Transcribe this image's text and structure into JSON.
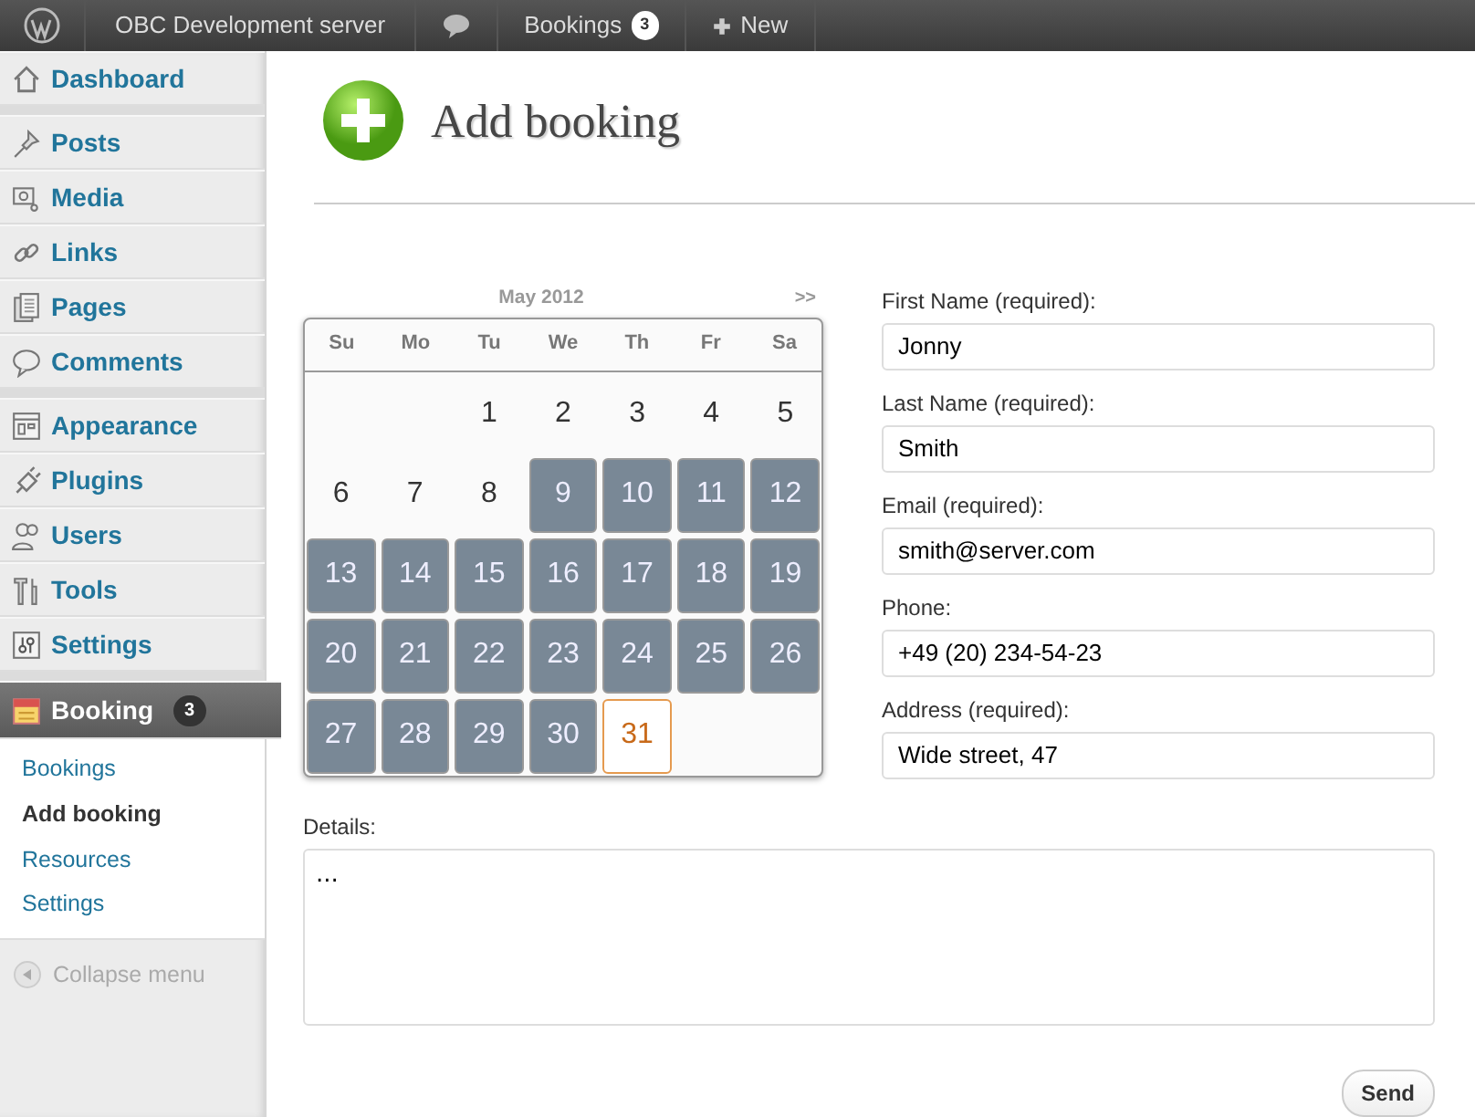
{
  "admin_bar": {
    "site": "OBC Development server",
    "bookings_label": "Bookings",
    "bookings_count": "3",
    "new_label": "New"
  },
  "sidebar": {
    "groups": [
      [
        {
          "label": "Dashboard",
          "kind": "house",
          "selected": false
        }
      ],
      [
        {
          "label": "Posts",
          "kind": "pin",
          "selected": false
        },
        {
          "label": "Media",
          "kind": "media",
          "selected": false
        },
        {
          "label": "Links",
          "kind": "link",
          "selected": false
        },
        {
          "label": "Pages",
          "kind": "pages",
          "selected": false
        },
        {
          "label": "Comments",
          "kind": "comment",
          "selected": false
        }
      ],
      [
        {
          "label": "Appearance",
          "kind": "layout",
          "selected": false
        },
        {
          "label": "Plugins",
          "kind": "plug",
          "selected": false
        },
        {
          "label": "Users",
          "kind": "users",
          "selected": false
        },
        {
          "label": "Tools",
          "kind": "tools",
          "selected": false
        },
        {
          "label": "Settings",
          "kind": "sliders",
          "selected": false
        }
      ],
      [
        {
          "label": "Booking",
          "kind": "calendar",
          "selected": true,
          "badge": "3",
          "children": [
            {
              "label": "Bookings",
              "selected": false
            },
            {
              "label": "Add booking",
              "selected": true
            },
            {
              "label": "Resources",
              "selected": false
            },
            {
              "label": "Settings",
              "selected": false
            }
          ]
        }
      ]
    ],
    "collapse": "Collapse menu"
  },
  "page": {
    "title": "Add booking"
  },
  "calendar": {
    "month": "May 2012",
    "next": ">>",
    "weekdays": [
      "Su",
      "Mo",
      "Tu",
      "We",
      "Th",
      "Fr",
      "Sa"
    ],
    "weeks": [
      [
        {
          "day": "1",
          "booked": false,
          "selected": false
        },
        {
          "day": "2",
          "booked": false,
          "selected": false
        },
        {
          "day": "3",
          "booked": false,
          "selected": false
        },
        {
          "day": "4",
          "booked": false,
          "selected": false
        },
        {
          "day": "5",
          "booked": false,
          "selected": false
        }
      ],
      [
        {
          "day": "6",
          "booked": false,
          "selected": false
        },
        {
          "day": "7",
          "booked": false,
          "selected": false
        },
        {
          "day": "8",
          "booked": false,
          "selected": false
        },
        {
          "day": "9",
          "booked": true,
          "selected": false
        },
        {
          "day": "10",
          "booked": true,
          "selected": false
        },
        {
          "day": "11",
          "booked": true,
          "selected": false
        },
        {
          "day": "12",
          "booked": true,
          "selected": false
        }
      ],
      [
        {
          "day": "13",
          "booked": true,
          "selected": false
        },
        {
          "day": "14",
          "booked": true,
          "selected": false
        },
        {
          "day": "15",
          "booked": true,
          "selected": false
        },
        {
          "day": "16",
          "booked": true,
          "selected": false
        },
        {
          "day": "17",
          "booked": true,
          "selected": false
        },
        {
          "day": "18",
          "booked": true,
          "selected": false
        },
        {
          "day": "19",
          "booked": true,
          "selected": false
        }
      ],
      [
        {
          "day": "20",
          "booked": true,
          "selected": false
        },
        {
          "day": "21",
          "booked": true,
          "selected": false
        },
        {
          "day": "22",
          "booked": true,
          "selected": false
        },
        {
          "day": "23",
          "booked": true,
          "selected": false
        },
        {
          "day": "24",
          "booked": true,
          "selected": false
        },
        {
          "day": "25",
          "booked": true,
          "selected": false
        },
        {
          "day": "26",
          "booked": true,
          "selected": false
        }
      ],
      [
        {
          "day": "27",
          "booked": true,
          "selected": false
        },
        {
          "day": "28",
          "booked": true,
          "selected": false
        },
        {
          "day": "29",
          "booked": true,
          "selected": false
        },
        {
          "day": "30",
          "booked": true,
          "selected": false
        },
        {
          "day": "31",
          "booked": false,
          "selected": true
        }
      ]
    ]
  },
  "form": {
    "fields": [
      {
        "label": "First Name (required):",
        "value": "Jonny"
      },
      {
        "label": "Last Name (required):",
        "value": "Smith"
      },
      {
        "label": "Email (required):",
        "value": "smith@server.com"
      },
      {
        "label": "Phone:",
        "value": "+49 (20) 234-54-23"
      },
      {
        "label": "Address (required):",
        "value": "Wide street, 47"
      }
    ],
    "details_label": "Details:",
    "details_value": "...",
    "submit": "Send"
  }
}
